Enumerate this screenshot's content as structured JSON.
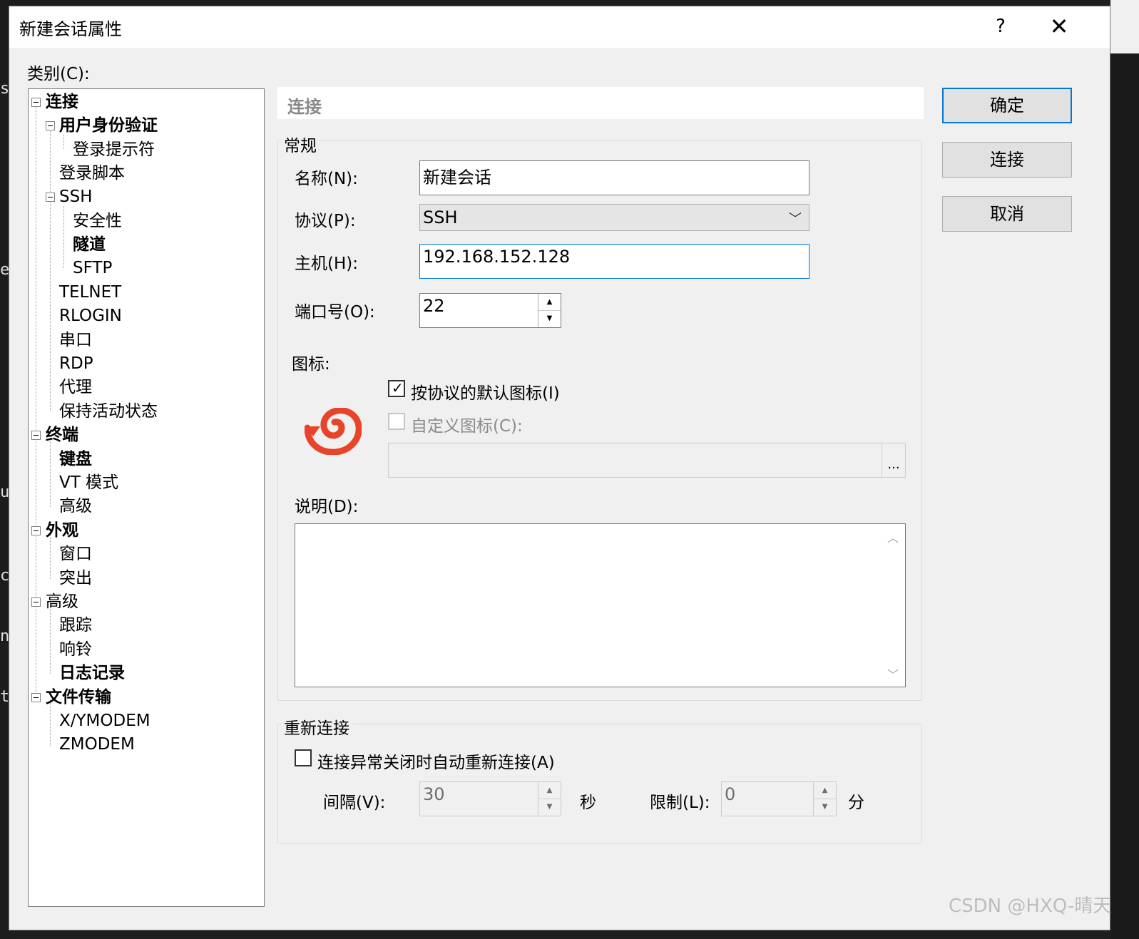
{
  "background": {
    "edge_chars": [
      "s",
      "e",
      "u",
      "c",
      "n",
      "t"
    ]
  },
  "window": {
    "title": "新建会话属性",
    "help": "?",
    "close": "✕"
  },
  "category": {
    "label": "类别(C):",
    "tree": [
      {
        "label": "连接",
        "bold": true
      },
      {
        "label": "用户身份验证",
        "bold": true
      },
      {
        "label": "登录提示符",
        "bold": false
      },
      {
        "label": "登录脚本",
        "bold": false
      },
      {
        "label": "SSH",
        "bold": false
      },
      {
        "label": "安全性",
        "bold": false
      },
      {
        "label": "隧道",
        "bold": true
      },
      {
        "label": "SFTP",
        "bold": false
      },
      {
        "label": "TELNET",
        "bold": false
      },
      {
        "label": "RLOGIN",
        "bold": false
      },
      {
        "label": "串口",
        "bold": false
      },
      {
        "label": "RDP",
        "bold": false
      },
      {
        "label": "代理",
        "bold": false
      },
      {
        "label": "保持活动状态",
        "bold": false
      },
      {
        "label": "终端",
        "bold": true
      },
      {
        "label": "键盘",
        "bold": true
      },
      {
        "label": "VT 模式",
        "bold": false
      },
      {
        "label": "高级",
        "bold": false
      },
      {
        "label": "外观",
        "bold": true
      },
      {
        "label": "窗口",
        "bold": false
      },
      {
        "label": "突出",
        "bold": false
      },
      {
        "label": "高级",
        "bold": false
      },
      {
        "label": "跟踪",
        "bold": false
      },
      {
        "label": "响铃",
        "bold": false
      },
      {
        "label": "日志记录",
        "bold": true
      },
      {
        "label": "文件传输",
        "bold": true
      },
      {
        "label": "X/YMODEM",
        "bold": false
      },
      {
        "label": "ZMODEM",
        "bold": false
      }
    ]
  },
  "panel": {
    "header": "连接",
    "general": {
      "group_label": "常规",
      "name_label": "名称(N):",
      "name_value": "新建会话",
      "protocol_label": "协议(P):",
      "protocol_value": "SSH",
      "host_label": "主机(H):",
      "host_value": "192.168.152.128",
      "port_label": "端口号(O):",
      "port_value": "22",
      "icon_label": "图标:",
      "default_icon_label": "按协议的默认图标(I)",
      "default_icon_checked": true,
      "custom_icon_label": "自定义图标(C):",
      "custom_icon_checked": false,
      "browse_label": "...",
      "description_label": "说明(D):",
      "description_value": ""
    },
    "reconnect": {
      "group_label": "重新连接",
      "auto_reconnect_label": "连接异常关闭时自动重新连接(A)",
      "auto_reconnect_checked": false,
      "interval_label": "间隔(V):",
      "interval_value": "30",
      "interval_unit": "秒",
      "limit_label": "限制(L):",
      "limit_value": "0",
      "limit_unit": "分"
    }
  },
  "buttons": {
    "ok": "确定",
    "connect": "连接",
    "cancel": "取消"
  },
  "icons": {
    "session_icon": "xshell-spiral-icon",
    "spin_up": "▲",
    "spin_down": "▼",
    "scroll_up": "︿",
    "scroll_down": "﹀",
    "dropdown": "﹀",
    "checkmark": "✓"
  },
  "colors": {
    "accent": "#0078d7",
    "icon_red": "#e8442a"
  },
  "watermark": "CSDN @HXQ-晴天"
}
